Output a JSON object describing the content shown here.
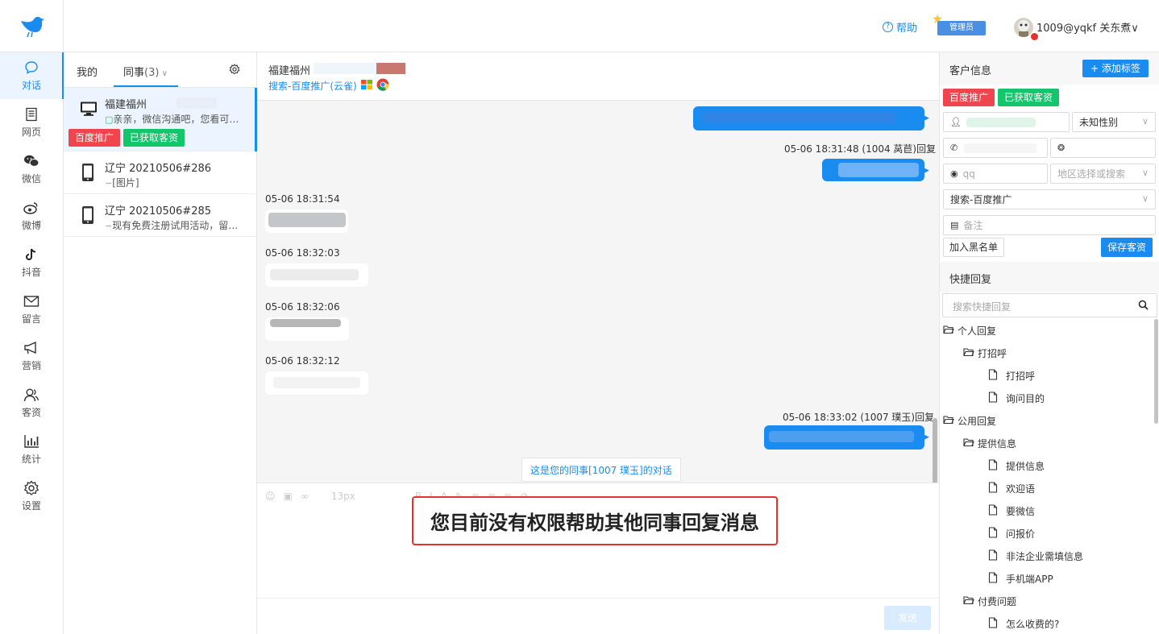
{
  "header": {
    "help_label": "帮助",
    "admin_badge": "管理员",
    "user_name": "1009@yqkf 关东煮∨"
  },
  "nav": {
    "items": [
      {
        "label": "对话",
        "icon": "chat-bubble-icon",
        "active": true
      },
      {
        "label": "网页",
        "icon": "web-page-icon"
      },
      {
        "label": "微信",
        "icon": "wechat-icon"
      },
      {
        "label": "微博",
        "icon": "weibo-icon"
      },
      {
        "label": "抖音",
        "icon": "douyin-icon"
      },
      {
        "label": "留言",
        "icon": "mail-icon"
      },
      {
        "label": "营销",
        "icon": "megaphone-icon"
      },
      {
        "label": "客资",
        "icon": "customers-icon"
      },
      {
        "label": "统计",
        "icon": "chart-icon"
      },
      {
        "label": "设置",
        "icon": "gear-icon"
      }
    ]
  },
  "list": {
    "tab_mine": "我的",
    "tab_colleague": "同事",
    "tab_colleague_count": "(3)",
    "conversations": [
      {
        "title": "福建福州",
        "message": "亲亲，微信沟通吧，您看可以吗",
        "device": "desktop-icon",
        "tags": [
          "百度推广",
          "已获取客资"
        ]
      },
      {
        "title": "辽宁 20210506#286",
        "message": "[图片]",
        "device": "mobile-icon",
        "tags": []
      },
      {
        "title": "辽宁 20210506#285",
        "message": "现有免费注册试用活动，留个联系方式",
        "device": "mobile-icon",
        "tags": []
      }
    ]
  },
  "chat": {
    "title": "福建福州",
    "source": "搜索-百度推广(云雀)",
    "timestamps": [
      "05-06 18:31:48 (1004 莴苣)回复",
      "05-06 18:31:54",
      "05-06 18:32:03",
      "05-06 18:32:06",
      "05-06 18:32:12",
      "05-06 18:33:02 (1007 璞玉)回复"
    ],
    "notice": "这是您的同事[1007 璞玉]的对话",
    "font_size": "13px",
    "permission_message": "您目前没有权限帮助其他同事回复消息",
    "send_label": "发送"
  },
  "customer": {
    "section_title": "客户信息",
    "add_tag_label": "+ 添加标签",
    "tags": [
      "百度推广",
      "已获取客资"
    ],
    "gender": "未知性别",
    "qq_placeholder": "qq",
    "region_placeholder": "地区选择或搜索",
    "source": "搜索-百度推广",
    "remark_placeholder": "备注",
    "blacklist_label": "加入黑名单",
    "save_label": "保存客资"
  },
  "quick_reply": {
    "title": "快捷回复",
    "search_placeholder": "搜索快捷回复",
    "tree": [
      {
        "label": "个人回复",
        "level": 0,
        "type": "folder"
      },
      {
        "label": "打招呼",
        "level": 1,
        "type": "folder"
      },
      {
        "label": "打招呼",
        "level": 2,
        "type": "file"
      },
      {
        "label": "询问目的",
        "level": 2,
        "type": "file"
      },
      {
        "label": "公用回复",
        "level": 0,
        "type": "folder"
      },
      {
        "label": "提供信息",
        "level": 1,
        "type": "folder"
      },
      {
        "label": "提供信息",
        "level": 2,
        "type": "file"
      },
      {
        "label": "欢迎语",
        "level": 2,
        "type": "file"
      },
      {
        "label": "要微信",
        "level": 2,
        "type": "file"
      },
      {
        "label": "问报价",
        "level": 2,
        "type": "file"
      },
      {
        "label": "非法企业需填信息",
        "level": 2,
        "type": "file"
      },
      {
        "label": "手机端APP",
        "level": 2,
        "type": "file"
      },
      {
        "label": "付费问题",
        "level": 1,
        "type": "folder"
      },
      {
        "label": "怎么收费的?",
        "level": 2,
        "type": "file"
      }
    ]
  },
  "colors": {
    "accent": "#1a8cf0",
    "tag_red": "#f0454f",
    "tag_green": "#13c56b",
    "alert_border": "#e5322d"
  }
}
